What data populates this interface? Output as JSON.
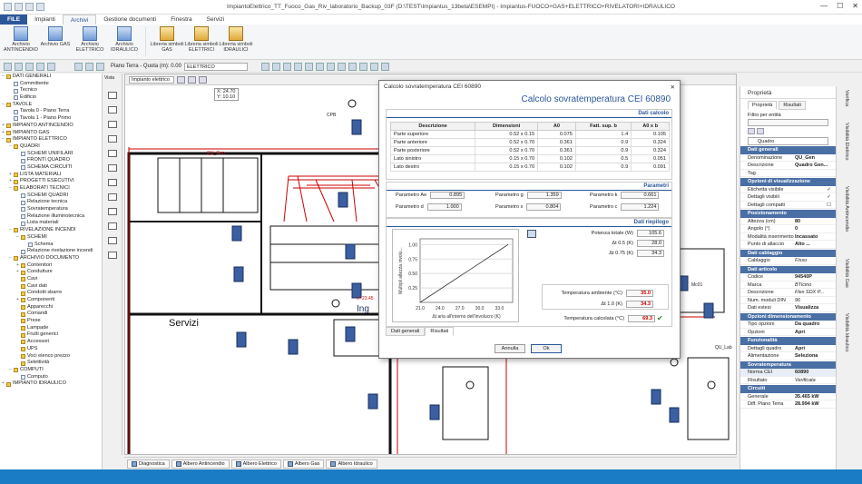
{
  "window": {
    "title": "ImpiantoElettrico_TT_Fuoco_Gas_Riv_laboratorio_Backup_03F (D:\\TEST\\Impiantus_13beta\\ESEMPI) - Impiantus-FUOCO+GAS+ELETTRICO+RIVELATORI+IDRAULICO",
    "min": "—",
    "max": "☐",
    "close": "✕"
  },
  "menu": [
    "FILE",
    "Impianti",
    "Archivi",
    "Gestione documenti",
    "Finestra",
    "Servizi"
  ],
  "ribbon": [
    "Archivio ANTINCENDIO",
    "Archivio GAS",
    "Archivio ELETTRICO",
    "Archivio IDRAULICO",
    "Libreria simboli GAS",
    "Libreria simboli ELETTRICI",
    "Libreria simboli IDRAULICI"
  ],
  "toolbar": {
    "piano_label": "Piano Terra - Quota (m): 0.00",
    "layer": "ELETTRICO"
  },
  "viewbar": {
    "vista_label": "Vista",
    "vista_value": "Impianto elettrico"
  },
  "coords": {
    "x": "X: 24.70",
    "y": "Y: 10.10"
  },
  "tree": [
    {
      "d": 0,
      "ex": "−",
      "t": "DATI GENERALI"
    },
    {
      "d": 1,
      "ex": "",
      "t": "Committente",
      "doc": true
    },
    {
      "d": 1,
      "ex": "",
      "t": "Tecnico",
      "doc": true
    },
    {
      "d": 1,
      "ex": "",
      "t": "Edificio",
      "doc": true
    },
    {
      "d": 0,
      "ex": "−",
      "t": "TAVOLE"
    },
    {
      "d": 1,
      "ex": "",
      "t": "Tavola 0 - Piano Terra",
      "doc": true
    },
    {
      "d": 1,
      "ex": "",
      "t": "Tavola 1 - Piano Primo",
      "doc": true
    },
    {
      "d": 0,
      "ex": "+",
      "t": "IMPIANTO ANTINCENDIO"
    },
    {
      "d": 0,
      "ex": "+",
      "t": "IMPIANTO GAS"
    },
    {
      "d": 0,
      "ex": "−",
      "t": "IMPIANTO ELETTRICO"
    },
    {
      "d": 1,
      "ex": "−",
      "t": "QUADRI"
    },
    {
      "d": 2,
      "ex": "",
      "t": "SCHEMI UNIFILARI",
      "doc": true
    },
    {
      "d": 2,
      "ex": "",
      "t": "FRONTI QUADRO",
      "doc": true
    },
    {
      "d": 2,
      "ex": "",
      "t": "SCHEMA CIRCUITI",
      "doc": true
    },
    {
      "d": 1,
      "ex": "+",
      "t": "LISTA MATERIALI"
    },
    {
      "d": 1,
      "ex": "+",
      "t": "PROGETTI ESECUTIVI"
    },
    {
      "d": 1,
      "ex": "−",
      "t": "ELABORATI TECNICI"
    },
    {
      "d": 2,
      "ex": "",
      "t": "SCHEMI QUADRI",
      "doc": true
    },
    {
      "d": 2,
      "ex": "",
      "t": "Relazione tecnica",
      "doc": true
    },
    {
      "d": 2,
      "ex": "",
      "t": "Sovratemperatura",
      "doc": true
    },
    {
      "d": 2,
      "ex": "",
      "t": "Relazione illuminotecnica",
      "doc": true
    },
    {
      "d": 2,
      "ex": "",
      "t": "Lista materiali",
      "doc": true
    },
    {
      "d": 1,
      "ex": "−",
      "t": "RIVELAZIONE INCENDI"
    },
    {
      "d": 2,
      "ex": "−",
      "t": "SCHEMI"
    },
    {
      "d": 3,
      "ex": "",
      "t": "Schema",
      "doc": true
    },
    {
      "d": 2,
      "ex": "",
      "t": "Relazione rivelazione incendi",
      "doc": true
    },
    {
      "d": 1,
      "ex": "−",
      "t": "ARCHIVIO DOCUMENTO"
    },
    {
      "d": 2,
      "ex": "+",
      "t": "Contenitori"
    },
    {
      "d": 2,
      "ex": "+",
      "t": "Condutture"
    },
    {
      "d": 2,
      "ex": "",
      "t": "Cavi"
    },
    {
      "d": 2,
      "ex": "",
      "t": "Cavi dati"
    },
    {
      "d": 2,
      "ex": "",
      "t": "Condotti sbarre"
    },
    {
      "d": 2,
      "ex": "+",
      "t": "Componenti"
    },
    {
      "d": 2,
      "ex": "",
      "t": "Apparecchi"
    },
    {
      "d": 2,
      "ex": "",
      "t": "Comandi"
    },
    {
      "d": 2,
      "ex": "",
      "t": "Prese"
    },
    {
      "d": 2,
      "ex": "",
      "t": "Lampade"
    },
    {
      "d": 2,
      "ex": "",
      "t": "Frutti generici"
    },
    {
      "d": 2,
      "ex": "",
      "t": "Accessori"
    },
    {
      "d": 2,
      "ex": "",
      "t": "UPS"
    },
    {
      "d": 2,
      "ex": "",
      "t": "Voci elenco prezzo"
    },
    {
      "d": 2,
      "ex": "",
      "t": "Selettività"
    },
    {
      "d": 1,
      "ex": "−",
      "t": "COMPUTI"
    },
    {
      "d": 2,
      "ex": "",
      "t": "Computo",
      "doc": true
    },
    {
      "d": 0,
      "ex": "+",
      "t": "IMPIANTO IDRAULICO"
    }
  ],
  "drawing": {
    "room_label": "Servizi",
    "qu_gen": "QU_Gen",
    "room2": "Ing",
    "label3": "nº 23.45",
    "qu_lab": "QU_Lab",
    "cpb": "CPB",
    "m1": "Mc01"
  },
  "bottom_tabs": [
    "Diagnostica",
    "Albero Antincendio",
    "Albero Elettrico",
    "Albero Gas",
    "Albero Idraulico"
  ],
  "properties": {
    "title": "Proprietà",
    "tabs": [
      "Proprietà",
      "Risultati"
    ],
    "filter_label": "Filtro per entità",
    "object": "Quadro",
    "sections": [
      {
        "name": "Dati generali",
        "rows": [
          [
            "Denominazione",
            "QU_Gen"
          ],
          [
            "Descrizione",
            "Quadro Gen..."
          ],
          [
            "Tag",
            ""
          ]
        ]
      },
      {
        "name": "Opzioni di visualizzazione",
        "rows": [
          [
            "Etichetta visibile",
            "✓"
          ],
          [
            "Dettagli visibili",
            "✓"
          ],
          [
            "Dettagli compatti",
            "☐"
          ]
        ]
      },
      {
        "name": "Posizionamento",
        "rows": [
          [
            "Altezza (cm)",
            "80"
          ],
          [
            "Angolo (°)",
            "0"
          ],
          [
            "Modalità inserimento",
            "Incassato"
          ],
          [
            "Punto di allaccio",
            "Alto ..."
          ]
        ]
      },
      {
        "name": "Dati cablaggio",
        "rows": [
          [
            "Cablaggio",
            "Fisso"
          ]
        ]
      },
      {
        "name": "Dati articolo",
        "rows": [
          [
            "Codice",
            "94540P"
          ],
          [
            "Marca",
            "BTicino"
          ],
          [
            "Descrizione",
            "Flex SDX P..."
          ],
          [
            "Num. moduli DIN",
            "96"
          ],
          [
            "Dati estesi",
            "Visualizza"
          ]
        ]
      },
      {
        "name": "Opzioni dimensionamento",
        "rows": [
          [
            "Tipo opzioni",
            "Da quadro"
          ],
          [
            "Opzioni",
            "Apri"
          ]
        ]
      },
      {
        "name": "Funzionalità",
        "rows": [
          [
            "Dettagli quadro",
            "Apri"
          ],
          [
            "Alimentazione",
            "Seleziona"
          ]
        ]
      },
      {
        "name": "Sovratemperatura",
        "rows": [
          [
            "Norma CEI",
            "60890"
          ],
          [
            "Risultato",
            "Verificata"
          ]
        ]
      },
      {
        "name": "Circuiti",
        "rows": [
          [
            "Generale",
            "35.465 kW"
          ],
          [
            "Diff. Piano Terra",
            "28.994 kW"
          ]
        ]
      }
    ]
  },
  "side_tabs": [
    "Verifica",
    "Visibilità Elettrico",
    "Visibilità Antincendio",
    "Visibilità Gas",
    "Visibilità Idraulico"
  ],
  "dialog": {
    "window_title": "Calcolo sovratemperatura CEI 60890",
    "heading": "Calcolo sovratemperatura CEI 60890",
    "sec_calc": "Dati calcolo",
    "table_headers": [
      "Descrizione",
      "Dimensioni",
      "A0",
      "Fatt. sup. b",
      "A0 x b"
    ],
    "table_rows": [
      [
        "Parte superiore",
        "0.52 x 0.15",
        "0.075",
        "1.4",
        "0.105"
      ],
      [
        "Parte anteriore",
        "0.52 x 0.70",
        "0.361",
        "0.9",
        "0.324"
      ],
      [
        "Parte posteriore",
        "0.52 x 0.70",
        "0.361",
        "0.9",
        "0.324"
      ],
      [
        "Lato sinistro",
        "0.15 x 0.70",
        "0.102",
        "0.5",
        "0.051"
      ],
      [
        "Lato destro",
        "0.15 x 0.70",
        "0.102",
        "0.9",
        "0.091"
      ]
    ],
    "sec_params": "Parametri",
    "params": [
      [
        "Parametro Ae",
        "0.895"
      ],
      [
        "Parametro d",
        "1.000"
      ],
      [
        "Parametro g",
        "1.359"
      ],
      [
        "Parametro x",
        "0.804"
      ],
      [
        "Parametro k",
        "0.661"
      ],
      [
        "Parametro c",
        "1.224"
      ]
    ],
    "sec_summary": "Dati riepilogo",
    "summary": [
      [
        "Potenza totale (W)",
        "105.6"
      ],
      [
        "Δt 0.5 (K)",
        "28.0"
      ],
      [
        "Δt 0.75 (K)",
        "34.3"
      ]
    ],
    "temps": [
      [
        "Temperatura ambiente (°C)",
        "35.0"
      ],
      [
        "Δt 1.0 (K)",
        "34.3"
      ],
      [
        "Temperatura calcolata (°C)",
        "69.3"
      ]
    ],
    "tabs": [
      "Dati generali",
      "Risultati"
    ],
    "btn_cancel": "Annulla",
    "btn_ok": "Ok"
  },
  "chart_data": {
    "type": "line",
    "xlabel": "Δt aria all'interno dell'involucro (K)",
    "ylabel": "Multipli altezza involu...",
    "x_ticks": [
      "21.0",
      "24.0",
      "27.0",
      "30.0",
      "33.0"
    ],
    "y_ticks": [
      "1.00",
      "0.75",
      "0.50",
      "0.25"
    ],
    "xlim": [
      21.0,
      35.0
    ],
    "ylim": [
      0.0,
      1.1
    ],
    "series": [
      {
        "x": [
          21.0,
          34.3
        ],
        "y": [
          0.0,
          1.0
        ]
      }
    ]
  }
}
